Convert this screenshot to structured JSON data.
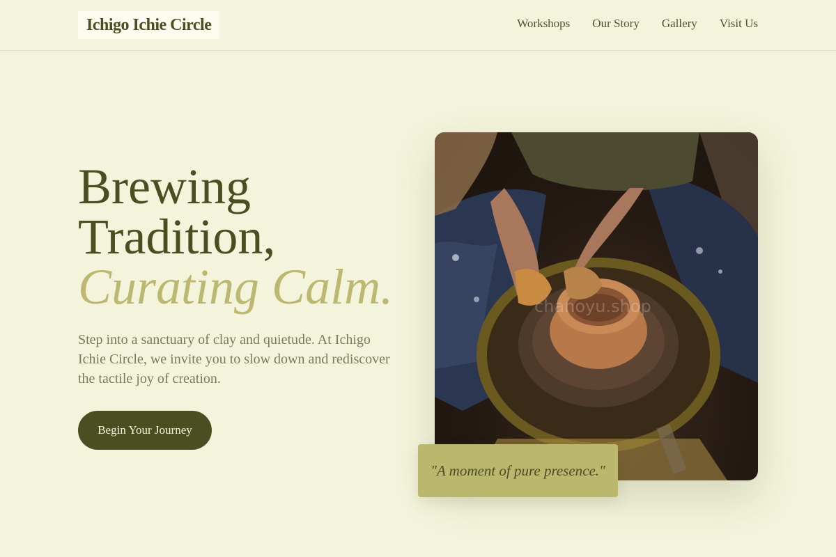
{
  "brand": {
    "name": "Ichigo Ichie Circle"
  },
  "nav": {
    "items": [
      {
        "label": "Workshops"
      },
      {
        "label": "Our Story"
      },
      {
        "label": "Gallery"
      },
      {
        "label": "Visit Us"
      }
    ]
  },
  "hero": {
    "title_line1": "Brewing",
    "title_line2": "Tradition,",
    "title_accent": "Curating Calm.",
    "description": "Step into a sanctuary of clay and quietude. At Ichigo Ichie Circle, we invite you to slow down and rediscover the tactile joy of creation.",
    "cta_label": "Begin Your Journey"
  },
  "image": {
    "watermark": "chanoyu.shop",
    "quote": "\"A moment of pure presence.\""
  },
  "colors": {
    "background": "#f4f4dc",
    "primary": "#4a4f22",
    "accent": "#bcb872",
    "text_muted": "#7a7b5a"
  }
}
